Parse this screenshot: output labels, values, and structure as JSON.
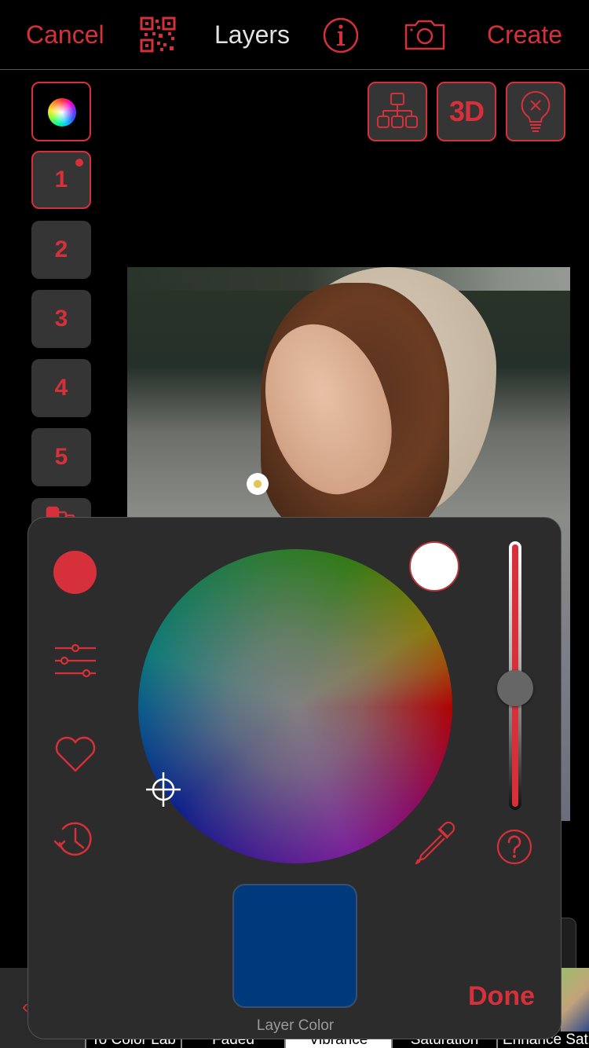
{
  "topbar": {
    "cancel_label": "Cancel",
    "title": "Layers",
    "create_label": "Create",
    "icons": [
      "qr-code-icon",
      "info-icon",
      "camera-icon"
    ]
  },
  "layer_column": {
    "color_button_icon": "color-ball-icon",
    "layers": [
      {
        "label": "1",
        "active": true,
        "has_dot": true
      },
      {
        "label": "2",
        "active": false
      },
      {
        "label": "3",
        "active": false
      },
      {
        "label": "4",
        "active": false
      },
      {
        "label": "5",
        "active": false
      }
    ],
    "more_icon": "layers-stack-icon"
  },
  "tools": {
    "hierarchy_icon": "hierarchy-icon",
    "three_d_label": "3D",
    "bulb_icon": "bulb-off-icon"
  },
  "photo": {
    "description": "Woman in straw hat with eyes closed in a flower field"
  },
  "color_panel": {
    "current_color": "#d6303a",
    "side_icons": [
      "sliders-icon",
      "heart-icon",
      "history-icon"
    ],
    "wheel_icon": "color-wheel",
    "crosshair_icon": "crosshair-icon",
    "secondary_swatch_color": "#ffffff",
    "brightness_value": 0.5,
    "eyedropper_icon": "eyedropper-icon",
    "help_icon": "help-icon",
    "layer_color": "#003a7c",
    "layer_color_label": "Layer Color",
    "done_label": "Done"
  },
  "bottom_strip": {
    "filters": [
      {
        "label": "To Color Lab",
        "selected": false
      },
      {
        "label": "Faded",
        "selected": false
      },
      {
        "label": "Vibrance",
        "selected": true
      },
      {
        "label": "Saturation",
        "selected": false
      },
      {
        "label": "Enhance Sat",
        "selected": false
      }
    ]
  },
  "colors": {
    "accent": "#d6303a",
    "background": "#000000",
    "panel": "#2c2c2c",
    "button": "#353535"
  }
}
